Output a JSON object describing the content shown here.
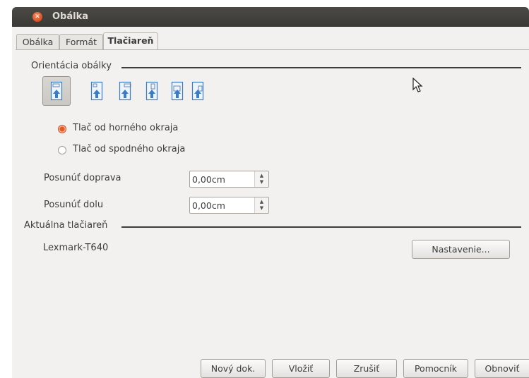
{
  "window": {
    "title": "Obálka"
  },
  "tabs": [
    {
      "label": "Obálka",
      "active": false
    },
    {
      "label": "Formát",
      "active": false
    },
    {
      "label": "Tlačiareň",
      "active": true
    }
  ],
  "orientation": {
    "section_label": "Orientácia obálky",
    "options_count_shown": 6,
    "selected_index": 0,
    "radio_top_label": "Tlač od horného okraja",
    "radio_bottom_label": "Tlač od spodného okraja",
    "radio_selected": "top"
  },
  "shift": {
    "right_label": "Posunúť doprava",
    "right_value": "0,00cm",
    "down_label": "Posunúť dolu",
    "down_value": "0,00cm"
  },
  "printer": {
    "section_label": "Aktuálna tlačiareň",
    "name": "Lexmark-T640",
    "settings_button": "Nastavenie..."
  },
  "footer": {
    "new_doc": "Nový dok.",
    "insert": "Vložiť",
    "cancel": "Zrušiť",
    "help": "Pomocník",
    "reset": "Obnoviť"
  },
  "colors": {
    "titlebar": "#3c3b37",
    "close_button": "#e0572a",
    "dialog_bg": "#f2f1f0",
    "radio_accent": "#e25b23",
    "envelope_blue": "#3b7dc4"
  }
}
